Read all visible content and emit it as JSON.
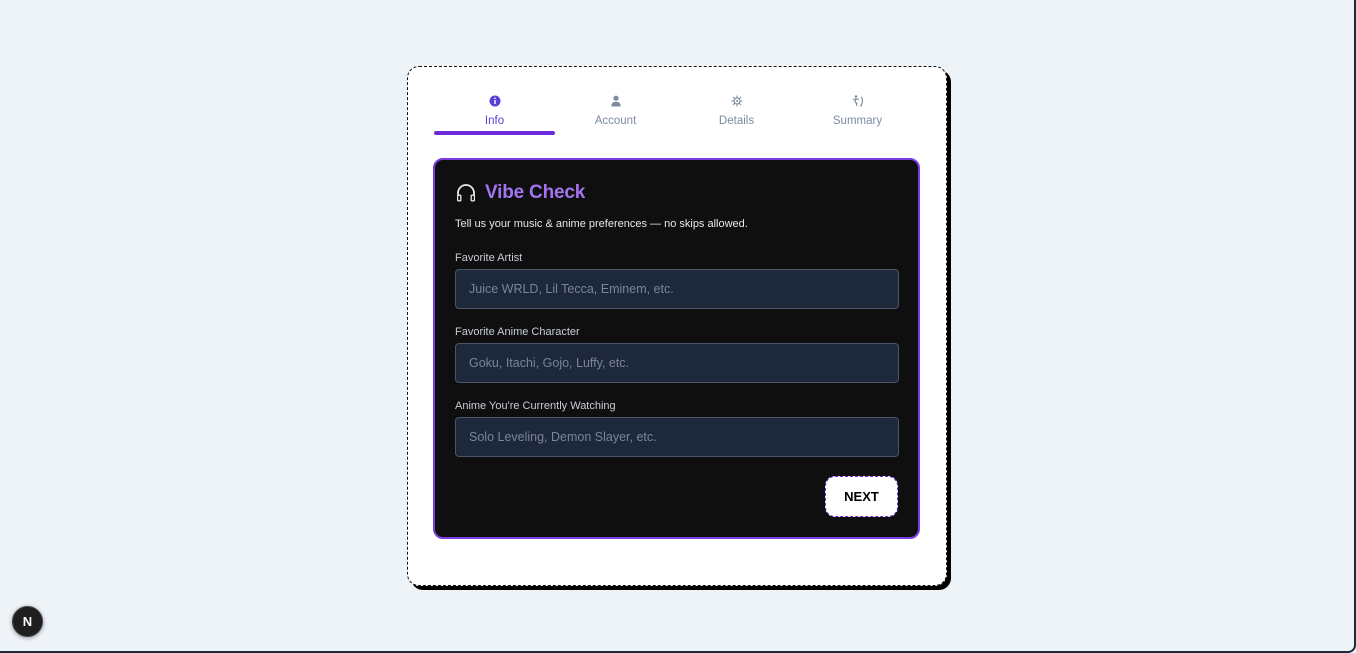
{
  "tabs": [
    {
      "label": "Info",
      "icon": "info-icon",
      "active": true
    },
    {
      "label": "Account",
      "icon": "user-icon",
      "active": false
    },
    {
      "label": "Details",
      "icon": "virus-icon",
      "active": false
    },
    {
      "label": "Summary",
      "icon": "skater-icon",
      "active": false
    }
  ],
  "panel": {
    "title": "Vibe Check",
    "title_icon": "headphones-icon",
    "subtitle": "Tell us your music & anime preferences — no skips allowed.",
    "fields": [
      {
        "label": "Favorite Artist",
        "value": "",
        "placeholder": "Juice WRLD, Lil Tecca, Eminem, etc."
      },
      {
        "label": "Favorite Anime Character",
        "value": "",
        "placeholder": "Goku, Itachi, Gojo, Luffy, etc."
      },
      {
        "label": "Anime You're Currently Watching",
        "value": "",
        "placeholder": "Solo Leveling, Demon Slayer, etc."
      }
    ],
    "next_label": "NEXT"
  },
  "dev_badge": {
    "label": "N"
  },
  "colors": {
    "accent": "#6c2bd9",
    "title": "#a374f0",
    "panel_bg": "#0f0f10",
    "input_bg": "#1d283a",
    "page_bg": "#eef3f8"
  }
}
